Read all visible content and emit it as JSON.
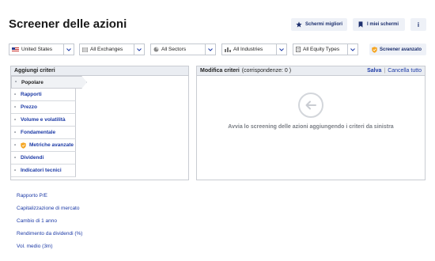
{
  "page": {
    "title": "Screener delle azioni"
  },
  "top_buttons": {
    "best": "Schermi migliori",
    "mine": "I miei schermi",
    "info": "i"
  },
  "filters": {
    "country": "United States",
    "exchange": "All Exchanges",
    "sector": "All Sectors",
    "industry": "All Industries",
    "equity_type": "All Equity Types",
    "advanced": "Screener avanzato"
  },
  "left_panel": {
    "header": "Aggiungi criteri",
    "categories": [
      {
        "label": "Popolare",
        "active": true
      },
      {
        "label": "Rapporti"
      },
      {
        "label": "Prezzo"
      },
      {
        "label": "Volume e volatilità"
      },
      {
        "label": "Fondamentale"
      },
      {
        "label": "Metriche avanzate",
        "premium": true
      },
      {
        "label": "Dividendi"
      },
      {
        "label": "Indicatori tecnici"
      }
    ],
    "criteria": [
      "Rapporto P/E",
      "Capitalizzazione di mercato",
      "Cambio di 1 anno",
      "Rendimento da dividendi (%)",
      "Vol. medio (3m)"
    ]
  },
  "right_panel": {
    "header": "Modifica criteri",
    "match": "(corrispondenze: 0 )",
    "save": "Salva",
    "separator": "|",
    "cancel": "Cancella tutto",
    "empty_message": "Avvia lo screening delle azioni aggiungendo i criteri da sinistra"
  },
  "colors": {
    "link": "#1c3aa6",
    "panel_header": "#eaedf2",
    "button_bg": "#eef1f7",
    "premium_orange": "#f5a623"
  }
}
